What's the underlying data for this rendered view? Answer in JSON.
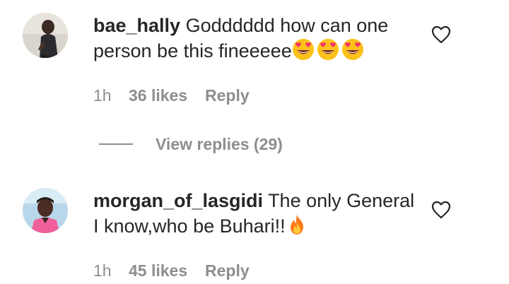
{
  "comments": [
    {
      "username": "bae_hally",
      "text": "Godddddd how can one person be this fineeeee",
      "emojis": [
        "heart-eyes-emoji",
        "heart-eyes-emoji",
        "heart-eyes-emoji"
      ],
      "time": "1h",
      "likes": "36 likes",
      "reply_label": "Reply",
      "view_replies": "View replies (29)"
    },
    {
      "username": "morgan_of_lasgidi",
      "text": "The only General I know,who be Buhari!!",
      "emojis": [
        "fire-emoji"
      ],
      "time": "1h",
      "likes": "45 likes",
      "reply_label": "Reply"
    }
  ],
  "icons": {
    "like": "heart-outline-icon"
  },
  "colors": {
    "text": "#262626",
    "secondary": "#8e8e8e",
    "background": "#ffffff"
  }
}
